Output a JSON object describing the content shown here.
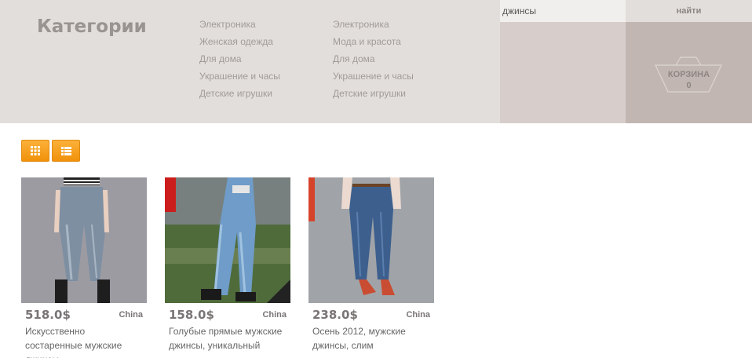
{
  "categories": {
    "title": "Категории",
    "column1": [
      "Электроника",
      "Женская одежда",
      "Для дома",
      "Украшение и часы",
      "Детские игрушки"
    ],
    "column2": [
      "Электроника",
      "Мода и красота",
      "Для дома",
      "Украшение и часы",
      "Детские игрушки"
    ]
  },
  "search": {
    "value": "джинсы",
    "button_label": "найти"
  },
  "cart": {
    "label": "КОРЗИНА",
    "count": "0"
  },
  "view_toggle": {
    "grid_icon": "grid-icon",
    "list_icon": "list-icon"
  },
  "products": [
    {
      "price": "518.0$",
      "origin": "China",
      "name": "Искусственно состаренные мужские джинсы"
    },
    {
      "price": "158.0$",
      "origin": "China",
      "name": "Голубые прямые мужские джинсы, уникальный"
    },
    {
      "price": "238.0$",
      "origin": "China",
      "name": "Осень 2012, мужские джинсы, слим"
    }
  ],
  "colors": {
    "header_bg": "#e2dedb",
    "search_bg": "#d7cdca",
    "cart_bg": "#c1b6b2",
    "accent_orange": "#f7a21b"
  }
}
